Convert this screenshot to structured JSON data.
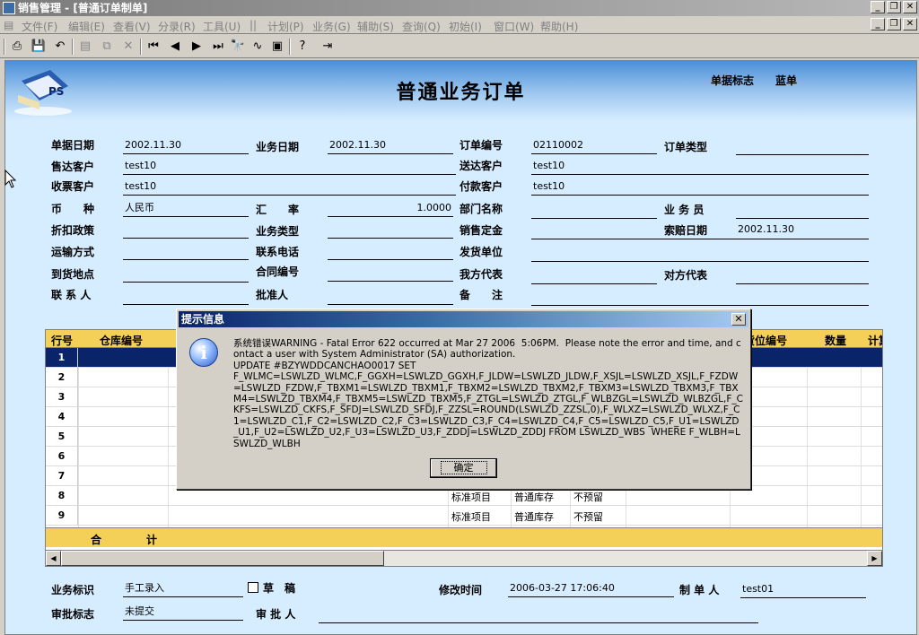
{
  "window": {
    "title": "销售管理 - [普通订单制单]"
  },
  "menu": {
    "items": [
      "文件(F)",
      "编辑(E)",
      "查看(V)",
      "分录(R)",
      "工具(U)",
      "||",
      "计划(P)",
      "业务(G)",
      "辅助(S)",
      "查询(Q)",
      "初始(I)",
      "窗口(W)",
      "帮助(H)"
    ]
  },
  "toolbar": {
    "icons": [
      "printer-icon",
      "save-icon",
      "undo-icon",
      "insert-row-icon",
      "copy-icon",
      "delete-icon",
      "first-icon",
      "prev-icon",
      "next-icon",
      "last-icon",
      "find-icon",
      "chart-icon",
      "calc-icon",
      "help-icon",
      "exit-icon"
    ]
  },
  "banner": {
    "title": "普通业务订单",
    "flag_label": "单据标志",
    "flag_value": "蓝单",
    "logo_text": "PS"
  },
  "header": {
    "doc_date_label": "单据日期",
    "doc_date": "2002.11.30",
    "biz_date_label": "业务日期",
    "biz_date": "2002.11.30",
    "order_no_label": "订单编号",
    "order_no": "02110002",
    "order_type_label": "订单类型",
    "order_type": "",
    "sold_to_label": "售达客户",
    "sold_to": "test10",
    "ship_to_label": "送达客户",
    "ship_to": "test10",
    "bill_to_label": "收票客户",
    "bill_to": "test10",
    "payer_label": "付款客户",
    "payer": "test10",
    "currency_label": "币　　种",
    "currency": "人民币",
    "rate_label": "汇　　率",
    "rate": "1.0000",
    "dept_label": "部门名称",
    "dept": "",
    "salesman_label": "业 务 员",
    "salesman": "",
    "discount_label": "折扣政策",
    "discount": "",
    "biz_type_label": "业务类型",
    "biz_type": "",
    "deposit_label": "销售定金",
    "deposit": "",
    "claim_date_label": "索赔日期",
    "claim_date": "2002.11.30",
    "transport_label": "运输方式",
    "transport": "",
    "phone_label": "联系电话",
    "phone": "",
    "ship_unit_label": "发货单位",
    "ship_unit": "",
    "dest_label": "到货地点",
    "dest": "",
    "contract_label": "合同编号",
    "contract": "",
    "our_rep_label": "我方代表",
    "our_rep": "",
    "their_rep_label": "对方代表",
    "their_rep": "",
    "contact_label": "联 系 人",
    "contact": "",
    "approver_label": "批准人",
    "approver": "",
    "remark_label": "备　　注",
    "remark": ""
  },
  "grid": {
    "columns": {
      "row_no": "行号",
      "warehouse": "仓库编号",
      "location": "货位编号",
      "qty": "数量",
      "calc": "计算"
    },
    "rows": [
      {
        "no": "1",
        "type": "",
        "stock": "",
        "reserve": ""
      },
      {
        "no": "2",
        "type": "",
        "stock": "",
        "reserve": ""
      },
      {
        "no": "3",
        "type": "",
        "stock": "",
        "reserve": ""
      },
      {
        "no": "4",
        "type": "",
        "stock": "",
        "reserve": ""
      },
      {
        "no": "5",
        "type": "",
        "stock": "",
        "reserve": ""
      },
      {
        "no": "6",
        "type": "",
        "stock": "",
        "reserve": ""
      },
      {
        "no": "7",
        "type": "",
        "stock": "",
        "reserve": ""
      },
      {
        "no": "8",
        "type": "标准项目",
        "stock": "普通库存",
        "reserve": "不预留"
      },
      {
        "no": "9",
        "type": "标准项目",
        "stock": "普通库存",
        "reserve": "不预留"
      }
    ],
    "total_a": "合",
    "total_b": "计"
  },
  "footer": {
    "biz_flag_label": "业务标识",
    "biz_flag": "手工录入",
    "draft_label": "草　稿",
    "modified_label": "修改时间",
    "modified": "2006-03-27 17:06:40",
    "maker_label": "制 单 人",
    "maker": "test01",
    "audit_flag_label": "审批标志",
    "audit_flag": "未提交",
    "auditor_label": "审 批 人",
    "auditor": ""
  },
  "dialog": {
    "title": "提示信息",
    "close": "✕",
    "icon": "i",
    "message": "系统错误WARNING - Fatal Error 622 occurred at Mar 27 2006  5:06PM.  Please note the error and time, and contact a user with System Administrator (SA) authorization.\nUPDATE #BZYWDDCANCHAO0017 SET\nF_WLMC=LSWLZD_WLMC,F_GGXH=LSWLZD_GGXH,F_JLDW=LSWLZD_JLDW,F_XSJL=LSWLZD_XSJL,F_FZDW=LSWLZD_FZDW,F_TBXM1=LSWLZD_TBXM1,F_TBXM2=LSWLZD_TBXM2,F_TBXM3=LSWLZD_TBXM3,F_TBXM4=LSWLZD_TBXM4,F_TBXM5=LSWLZD_TBXM5,F_ZTGL=LSWLZD_ZTGL,F_WLBZGL=LSWLZD_WLBZGL,F_CKFS=LSWLZD_CKFS,F_SFDJ=LSWLZD_SFDJ,F_ZZSL=ROUND(LSWLZD_ZZSL,0),F_WLXZ=LSWLZD_WLXZ,F_C1=LSWLZD_C1,F_C2=LSWLZD_C2,F_C3=LSWLZD_C3,F_C4=LSWLZD_C4,F_C5=LSWLZD_C5,F_U1=LSWLZD_U1,F_U2=LSWLZD_U2,F_U3=LSWLZD_U3,F_ZDDJ=LSWLZD_ZDDJ FROM LSWLZD_WBS  WHERE F_WLBH=LSWLZD_WLBH",
    "ok_label": "确定"
  }
}
